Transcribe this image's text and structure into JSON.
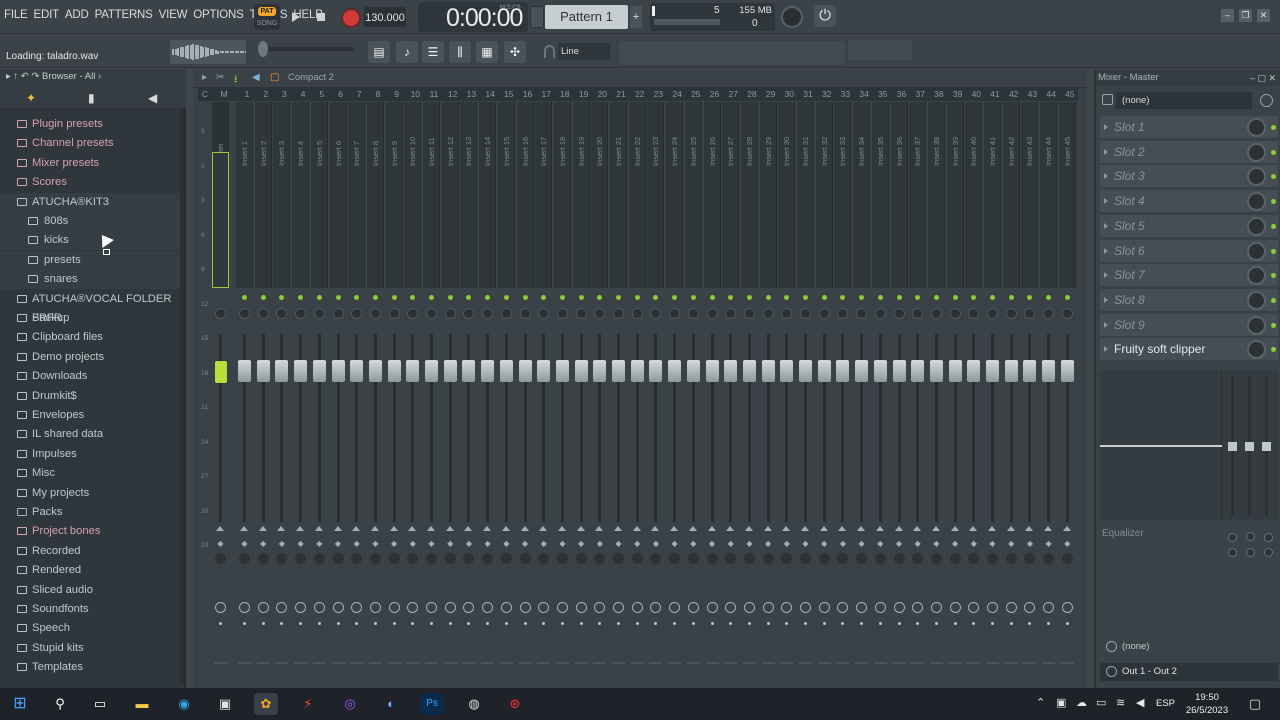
{
  "menu": [
    "FILE",
    "EDIT",
    "ADD",
    "PATTERNS",
    "VIEW",
    "OPTIONS",
    "TOOLS",
    "HELP"
  ],
  "transport": {
    "pat_label": "PAT",
    "song_label": "SONG",
    "tempo": "130.000",
    "time": "0:00:00",
    "time_units": "M:S:CS",
    "pattern": "Pattern 1"
  },
  "cpu": {
    "cpu_value": "5",
    "memory": "155 MB",
    "polyphony": "0"
  },
  "hint": "Loading: taladro.wav",
  "snap": "Line",
  "browser": {
    "title": "Browser - All",
    "items": [
      {
        "label": "Plugin presets",
        "type": "preset",
        "indent": 0
      },
      {
        "label": "Channel presets",
        "type": "preset",
        "indent": 0
      },
      {
        "label": "Mixer presets",
        "type": "preset",
        "indent": 0
      },
      {
        "label": "Scores",
        "type": "note",
        "indent": 0
      },
      {
        "label": "ATUCHA®KIT3",
        "type": "folder-open",
        "indent": 0
      },
      {
        "label": "808s",
        "type": "folder",
        "indent": 1
      },
      {
        "label": "kicks",
        "type": "folder",
        "indent": 1
      },
      {
        "label": "presets",
        "type": "folder",
        "indent": 1
      },
      {
        "label": "snares",
        "type": "folder",
        "indent": 1
      },
      {
        "label": "ATUCHA®VOCAL FOLDER FRFR",
        "type": "folder",
        "indent": 0
      },
      {
        "label": "Backup",
        "type": "folder",
        "indent": 0
      },
      {
        "label": "Clipboard files",
        "type": "folder",
        "indent": 0
      },
      {
        "label": "Demo projects",
        "type": "folder",
        "indent": 0
      },
      {
        "label": "Downloads",
        "type": "folder",
        "indent": 0
      },
      {
        "label": "Drumkit$",
        "type": "folder",
        "indent": 0
      },
      {
        "label": "Envelopes",
        "type": "folder",
        "indent": 0
      },
      {
        "label": "IL shared data",
        "type": "folder",
        "indent": 0
      },
      {
        "label": "Impulses",
        "type": "folder",
        "indent": 0
      },
      {
        "label": "Misc",
        "type": "folder",
        "indent": 0
      },
      {
        "label": "My projects",
        "type": "folder",
        "indent": 0
      },
      {
        "label": "Packs",
        "type": "pack",
        "indent": 0
      },
      {
        "label": "Project bones",
        "type": "preset",
        "indent": 0
      },
      {
        "label": "Recorded",
        "type": "plus",
        "indent": 0
      },
      {
        "label": "Rendered",
        "type": "plus",
        "indent": 0
      },
      {
        "label": "Sliced audio",
        "type": "plus",
        "indent": 0
      },
      {
        "label": "Soundfonts",
        "type": "folder",
        "indent": 0
      },
      {
        "label": "Speech",
        "type": "folder",
        "indent": 0
      },
      {
        "label": "Stupid kits",
        "type": "folder",
        "indent": 0
      },
      {
        "label": "Templates",
        "type": "folder",
        "indent": 0
      }
    ]
  },
  "mixer": {
    "layout": "Compact 2",
    "ruler_current": "C",
    "ruler_master": "M",
    "master_label": "Master",
    "insert_prefix": "Insert",
    "insert_count": 45,
    "scale_marks": [
      "3",
      "0",
      "3",
      "6",
      "9",
      "12",
      "15",
      "18",
      "21",
      "24",
      "27",
      "30",
      "33"
    ]
  },
  "mixer_master": {
    "title": "Mixer - Master",
    "preset": "(none)",
    "slots": [
      "Slot 1",
      "Slot 2",
      "Slot 3",
      "Slot 4",
      "Slot 5",
      "Slot 6",
      "Slot 7",
      "Slot 8",
      "Slot 9"
    ],
    "active_slot": "Fruity soft clipper",
    "eq_label": "Equalizer",
    "input": "(none)",
    "output": "Out 1 - Out 2"
  },
  "taskbar": {
    "lang": "ESP",
    "time": "19:50",
    "date": "26/5/2023"
  },
  "colors": {
    "accent_green": "#8ecb3a",
    "master_green": "#b9e03a",
    "record_red": "#d23a3a",
    "pat_orange": "#f5a623"
  }
}
